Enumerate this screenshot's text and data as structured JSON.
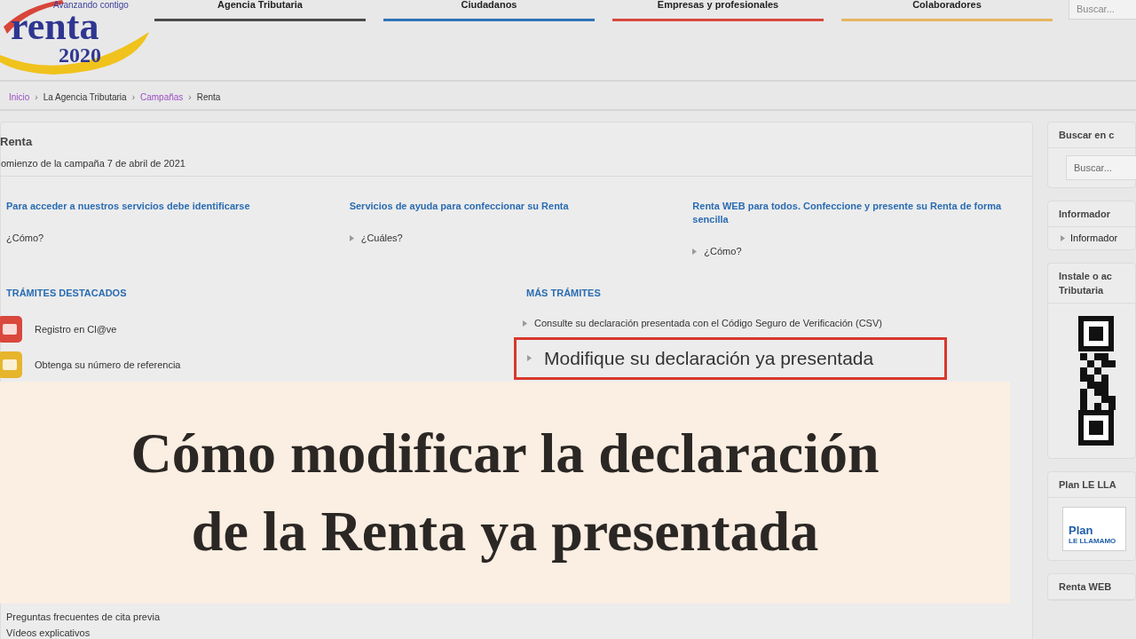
{
  "logo": {
    "tagline": "Avanzando contigo",
    "word": "renta",
    "year": "2020"
  },
  "nav_tabs": [
    {
      "label": "Agencia Tributaria",
      "color": "#4a4a4a"
    },
    {
      "label": "Ciudadanos",
      "color": "#2f74b8"
    },
    {
      "label": "Empresas y profesionales",
      "color": "#d8483c"
    },
    {
      "label": "Colaboradores",
      "color": "#e6b660"
    }
  ],
  "header_search": {
    "placeholder": "Buscar..."
  },
  "breadcrumb_separator": "›",
  "breadcrumb": [
    {
      "label": "Inicio",
      "visited": true
    },
    {
      "label": "La Agencia Tributaria",
      "visited": false
    },
    {
      "label": "Campañas",
      "visited": true
    },
    {
      "label": "Renta",
      "visited": false
    }
  ],
  "page": {
    "title": "Renta",
    "subtitle": "omienzo de la campaña 7 de abril de 2021"
  },
  "info_columns": [
    {
      "heading": "Para acceder a nuestros servicios debe identificarse",
      "link": "¿Cómo?"
    },
    {
      "heading": "Servicios de ayuda para confeccionar su Renta",
      "link": "¿Cuáles?"
    },
    {
      "heading": "Renta WEB para todos. Confeccione y presente su Renta de forma sencilla",
      "link": "¿Cómo?"
    }
  ],
  "featured": {
    "heading": "TRÁMITES DESTACADOS",
    "items": [
      {
        "label": "Registro en Cl@ve",
        "color": "#d9473d"
      },
      {
        "label": "Obtenga su número de referencia",
        "color": "#e7b52c"
      }
    ]
  },
  "more": {
    "heading": "MÁS TRÁMITES",
    "items": [
      {
        "label": "Consulte su declaración presentada con el Código Seguro de Verificación (CSV)",
        "highlighted": false
      },
      {
        "label": "Modifique su declaración ya presentada",
        "highlighted": true
      }
    ]
  },
  "help": {
    "items": [
      {
        "label": "Preguntas frecuentes de cita previa"
      },
      {
        "label": "Vídeos explicativos"
      }
    ]
  },
  "sidebar": [
    {
      "title": "Buscar en c",
      "kind": "search",
      "placeholder": "Buscar..."
    },
    {
      "title": "Informador",
      "kind": "links",
      "items": [
        "Informador"
      ]
    },
    {
      "title": "Instale o ac Tributaria",
      "kind": "qr"
    },
    {
      "title": "Plan LE LLA",
      "kind": "banner",
      "banner_title": "Plan",
      "banner_sub": "LE LLAMAMO"
    },
    {
      "title": "Renta WEB",
      "kind": "links"
    }
  ],
  "caption": {
    "lines": [
      "Cómo modificar la declaración",
      "de la Renta ya presentada"
    ]
  }
}
